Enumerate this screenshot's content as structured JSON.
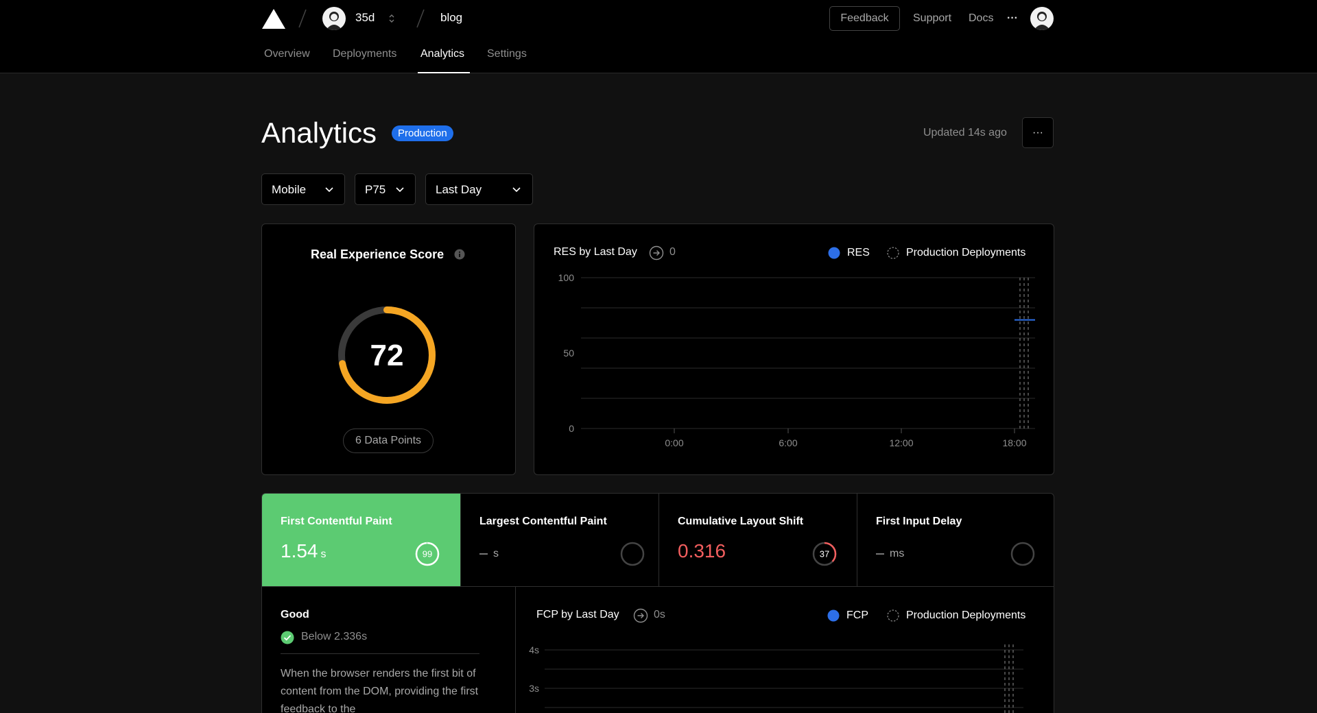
{
  "header": {
    "project": "35d",
    "repo": "blog",
    "feedback": "Feedback",
    "support": "Support",
    "docs": "Docs",
    "more": "···"
  },
  "tabs": [
    {
      "label": "Overview",
      "active": false
    },
    {
      "label": "Deployments",
      "active": false
    },
    {
      "label": "Analytics",
      "active": true
    },
    {
      "label": "Settings",
      "active": false
    }
  ],
  "page": {
    "title": "Analytics",
    "badge": "Production",
    "updated": "Updated 14s ago",
    "more": "···"
  },
  "filters": {
    "device": "Mobile",
    "percentile": "P75",
    "range": "Last Day"
  },
  "score_card": {
    "title": "Real Experience Score",
    "score": "72",
    "score_fraction": 0.72,
    "data_points": "6 Data Points",
    "ring_color": "#f5a623"
  },
  "res_chart": {
    "title": "RES by Last Day",
    "delta": "0",
    "legend_series": "RES",
    "legend_deployments": "Production Deployments",
    "series_color": "#2d6fe8"
  },
  "fcp_chart": {
    "title": "FCP by Last Day",
    "delta": "0s",
    "legend_series": "FCP",
    "legend_deployments": "Production Deployments"
  },
  "chart_data": [
    {
      "type": "line",
      "title": "RES by Last Day",
      "x_ticks": [
        "0:00",
        "6:00",
        "12:00",
        "18:00"
      ],
      "y_ticks": [
        "0",
        "50",
        "100"
      ],
      "ylim": [
        0,
        100
      ],
      "series": [
        {
          "name": "RES",
          "values": [
            72
          ]
        }
      ],
      "grid": true,
      "legend": "top-right"
    },
    {
      "type": "line",
      "title": "FCP by Last Day",
      "y_ticks": [
        "4s",
        "3s"
      ],
      "series": [
        {
          "name": "FCP",
          "values": []
        }
      ],
      "grid": true,
      "legend": "top-right"
    }
  ],
  "metrics": [
    {
      "title": "First Contentful Paint",
      "value": "1.54",
      "unit": "s",
      "score": "99",
      "score_fraction": 0.99
    },
    {
      "title": "Largest Contentful Paint",
      "value": "",
      "unit": "s",
      "score": ""
    },
    {
      "title": "Cumulative Layout Shift",
      "value": "0.316",
      "unit": "",
      "score": "37",
      "score_fraction": 0.37
    },
    {
      "title": "First Input Delay",
      "value": "",
      "unit": "ms",
      "score": ""
    }
  ],
  "detail": {
    "rating": "Good",
    "threshold": "Below 2.336s",
    "description": "When the browser renders the first bit of content from the DOM, providing the first feedback to the"
  },
  "colors": {
    "good": "#5ccb72",
    "poor": "#f25e5e",
    "accent": "#f5a623"
  }
}
